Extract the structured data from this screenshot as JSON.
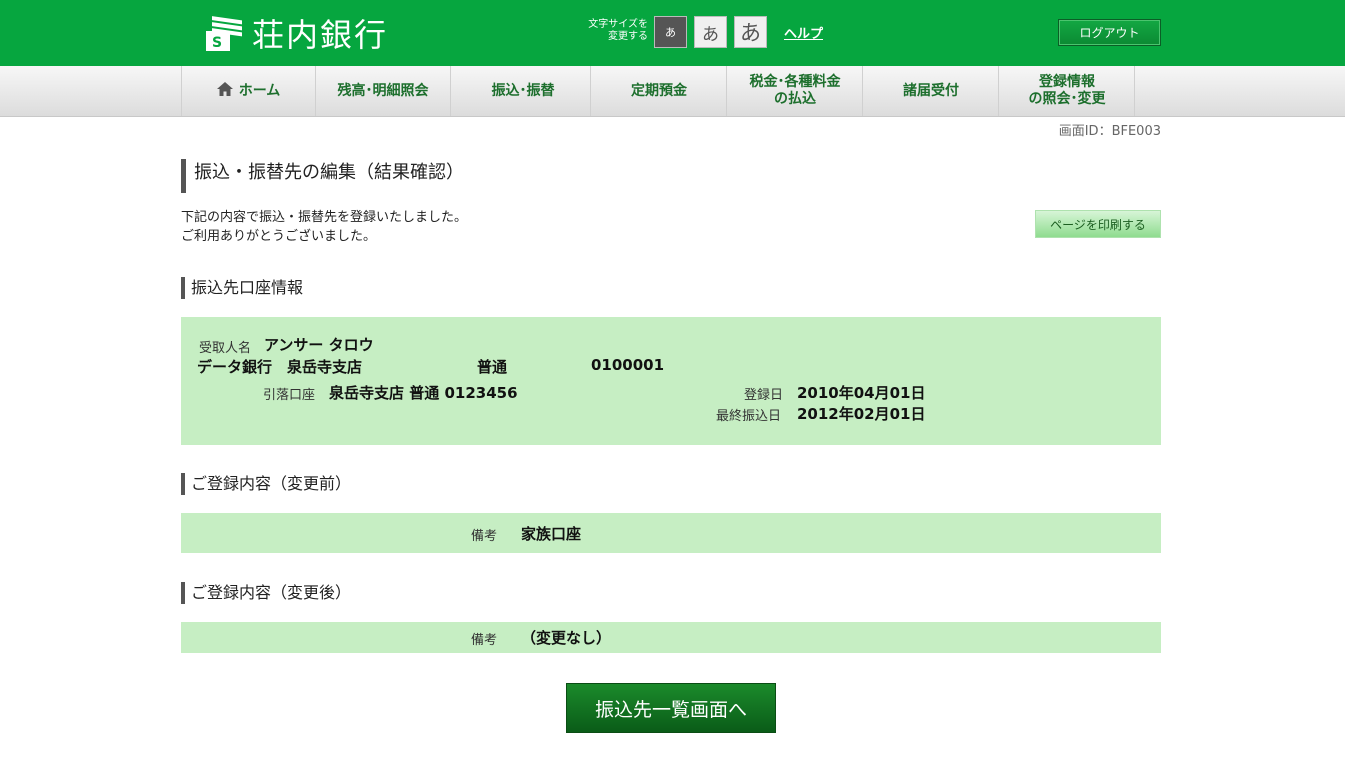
{
  "header": {
    "bank_name": "荘内銀行",
    "font_size_label": "文字サイズを\n変更する",
    "font_size_small": "あ",
    "font_size_mid": "あ",
    "font_size_large": "あ",
    "help": "ヘルプ",
    "logout": "ログアウト",
    "logo_icon": "bank-logo-icon",
    "brand_color": "#06a63f"
  },
  "nav": {
    "items": [
      {
        "label": "ホーム",
        "icon": "home-icon"
      },
      {
        "label": "残高･明細照会"
      },
      {
        "label": "振込･振替"
      },
      {
        "label": "定期預金"
      },
      {
        "label": "税金･各種料金\nの払込"
      },
      {
        "label": "諸届受付"
      },
      {
        "label": "登録情報\nの照会･変更"
      }
    ]
  },
  "screen_id": "画面ID：BFE003",
  "page_title": "振込・振替先の編集（結果確認）",
  "message": {
    "line1": "下記の内容で振込・振替先を登録いたしました。",
    "line2": "ご利用ありがとうございました。"
  },
  "print_button": "ページを印刷する",
  "account_section": {
    "title": "振込先口座情報",
    "recipient_label": "受取人名",
    "recipient_name": "アンサー タロウ",
    "bank_branch": "データ銀行　泉岳寺支店",
    "account_type": "普通",
    "account_number": "0100001",
    "debit_label": "引落口座",
    "debit_account": "泉岳寺支店 普通 0123456",
    "registered_label": "登録日",
    "registered_date": "2010年04月01日",
    "last_transfer_label": "最終振込日",
    "last_transfer_date": "2012年02月01日"
  },
  "before_section": {
    "title": "ご登録内容（変更前）",
    "note_label": "備考",
    "note_value": "家族口座"
  },
  "after_section": {
    "title": "ご登録内容（変更後）",
    "note_label": "備考",
    "note_value": "（変更なし）"
  },
  "primary_button": "振込先一覧画面へ",
  "colors": {
    "accent": "#06a63f",
    "info_box": "#c6eec3",
    "nav_text": "#1d6f2d",
    "primary_button": "#0f6d1f"
  }
}
